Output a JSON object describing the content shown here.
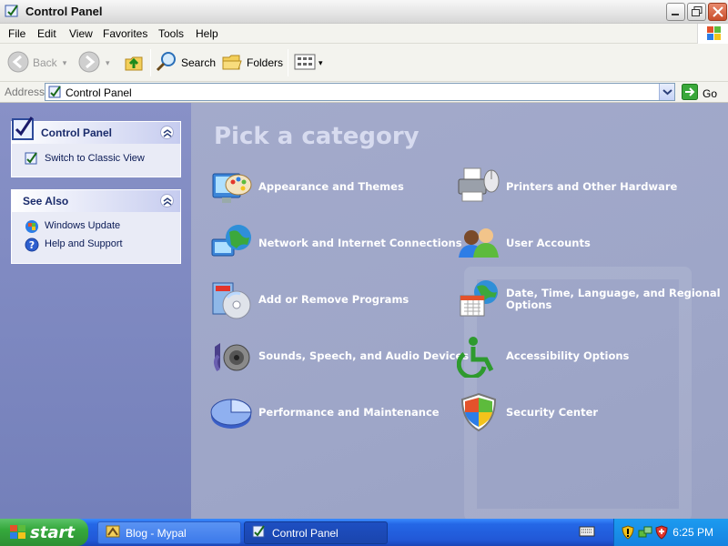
{
  "window": {
    "title": "Control Panel",
    "controls": [
      "minimize",
      "maximize",
      "close"
    ]
  },
  "menu": {
    "items": [
      "File",
      "Edit",
      "View",
      "Favorites",
      "Tools",
      "Help"
    ]
  },
  "toolbar": {
    "back_label": "Back",
    "search_label": "Search",
    "folders_label": "Folders"
  },
  "address": {
    "label": "Address",
    "value": "Control Panel",
    "go_label": "Go"
  },
  "sidebar": {
    "panel_title": "Control Panel",
    "panel_items": [
      {
        "label": "Switch to Classic View",
        "icon": "control-panel-icon"
      }
    ],
    "see_also_title": "See Also",
    "see_also_items": [
      {
        "label": "Windows Update",
        "icon": "windows-update-icon"
      },
      {
        "label": "Help and Support",
        "icon": "help-icon"
      }
    ]
  },
  "main": {
    "heading": "Pick a category",
    "categories": [
      {
        "label": "Appearance and Themes",
        "icon": "appearance-palette-icon"
      },
      {
        "label": "Printers and Other Hardware",
        "icon": "printer-icon"
      },
      {
        "label": "Network and Internet Connections",
        "icon": "network-globe-icon"
      },
      {
        "label": "User Accounts",
        "icon": "users-icon"
      },
      {
        "label": "Add or Remove Programs",
        "icon": "programs-cd-icon"
      },
      {
        "label": "Date, Time, Language, and Regional Options",
        "icon": "calendar-globe-icon"
      },
      {
        "label": "Sounds, Speech, and Audio Devices",
        "icon": "speaker-icon"
      },
      {
        "label": "Accessibility Options",
        "icon": "accessibility-icon"
      },
      {
        "label": "Performance and Maintenance",
        "icon": "pie-chart-icon"
      },
      {
        "label": "Security Center",
        "icon": "shield-icon"
      }
    ]
  },
  "taskbar": {
    "start_label": "start",
    "tasks": [
      {
        "label": "Blog - Mypal",
        "active": false
      },
      {
        "label": "Control Panel",
        "active": true
      }
    ],
    "clock": "6:25 PM"
  },
  "colors": {
    "main_background": "#9ea6c8",
    "taskbar": "#2157d6",
    "start_button": "#35a93c",
    "close_button": "#c94f2b"
  }
}
